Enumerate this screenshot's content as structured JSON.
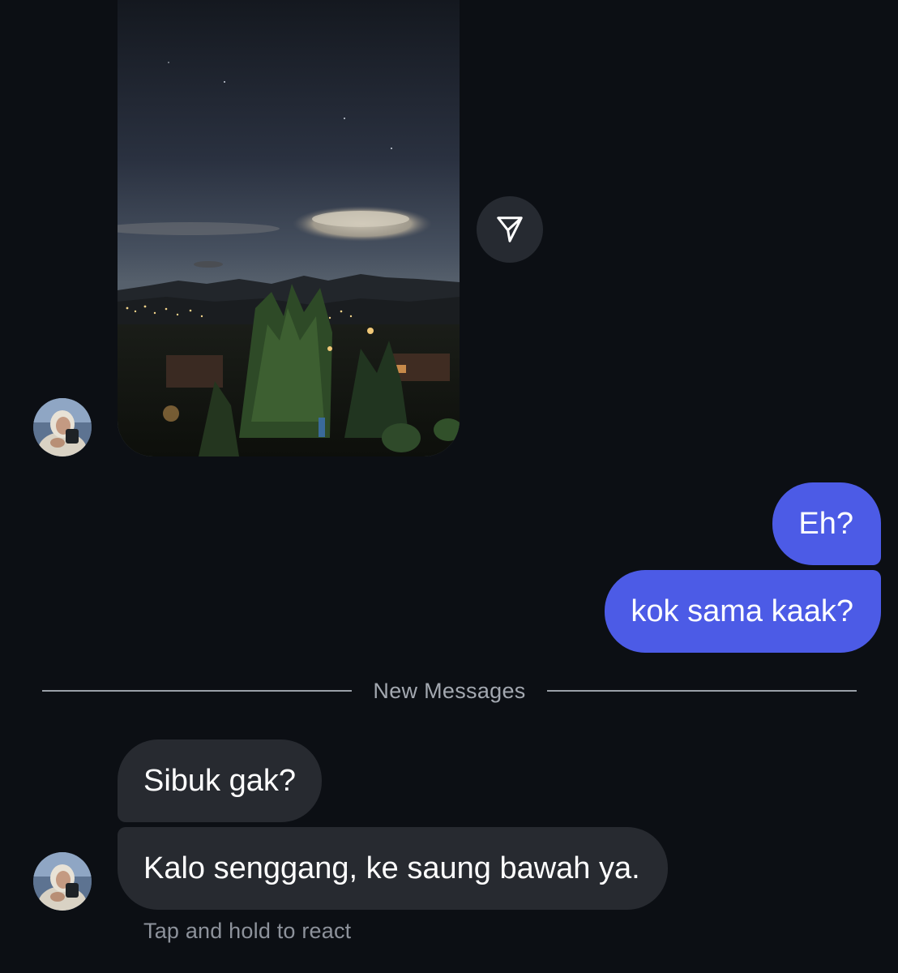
{
  "conversation": {
    "shared_photo": {
      "alt_subject": "night-landscape-with-lenticular-cloud",
      "share_icon": "paper-plane-icon"
    },
    "messages": [
      {
        "direction": "outgoing",
        "text": "Eh?"
      },
      {
        "direction": "outgoing",
        "text": "kok sama kaak?"
      },
      {
        "direction": "incoming",
        "text": "Sibuk gak?"
      },
      {
        "direction": "incoming",
        "text": "Kalo senggang, ke saung bawah ya."
      }
    ],
    "divider_label": "New Messages",
    "react_hint": "Tap and hold to react"
  },
  "colors": {
    "background": "#0c0f14",
    "outgoing_bubble": "#4c5be6",
    "incoming_bubble": "#272a30",
    "share_button": "#262a31"
  }
}
